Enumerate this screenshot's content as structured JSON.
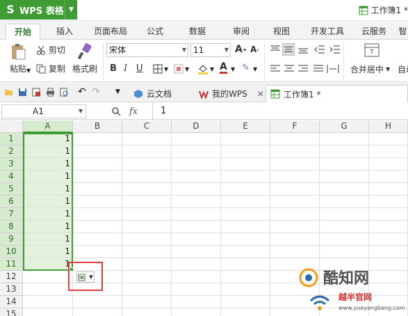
{
  "app": {
    "logo_text": "S",
    "name": "WPS 表格",
    "document_title": "工作簿1 *",
    "brand_color": "#3f9c35"
  },
  "ribbon_tabs": [
    "开始",
    "插入",
    "页面布局",
    "公式",
    "数据",
    "审阅",
    "视图",
    "开发工具",
    "云服务",
    "智"
  ],
  "active_tab": "开始",
  "ribbon": {
    "paste_label": "粘贴",
    "cut_label": "剪切",
    "copy_label": "复制",
    "format_painter_label": "格式刷",
    "font_name": "宋体",
    "font_size": "11",
    "merge_center_label": "合并居中",
    "autowrap_label": "自动"
  },
  "doc_tabs": [
    {
      "label": "云文档",
      "icon": "cloud-doc-icon"
    },
    {
      "label": "我的WPS",
      "icon": "wps-logo-icon"
    },
    {
      "label": "工作簿1 *",
      "icon": "spreadsheet-icon"
    }
  ],
  "formula_bar": {
    "name_box": "A1",
    "fx_label": "fx",
    "value": "1"
  },
  "sheet": {
    "columns": [
      "A",
      "B",
      "C",
      "D",
      "E",
      "F",
      "G",
      "H"
    ],
    "rows": [
      "1",
      "2",
      "3",
      "4",
      "5",
      "6",
      "7",
      "8",
      "9",
      "10",
      "11",
      "12",
      "13",
      "14",
      "15"
    ],
    "column_a_values": [
      "1",
      "1",
      "1",
      "1",
      "1",
      "1",
      "1",
      "1",
      "1",
      "1",
      "1"
    ],
    "selected_range": "A1:A11",
    "selection_color": "#3f9c35",
    "highlight_color": "#e03a3a"
  },
  "watermark": {
    "main": "酷知网",
    "sub": "越半官网",
    "url": "www.yueyangbang.com"
  }
}
